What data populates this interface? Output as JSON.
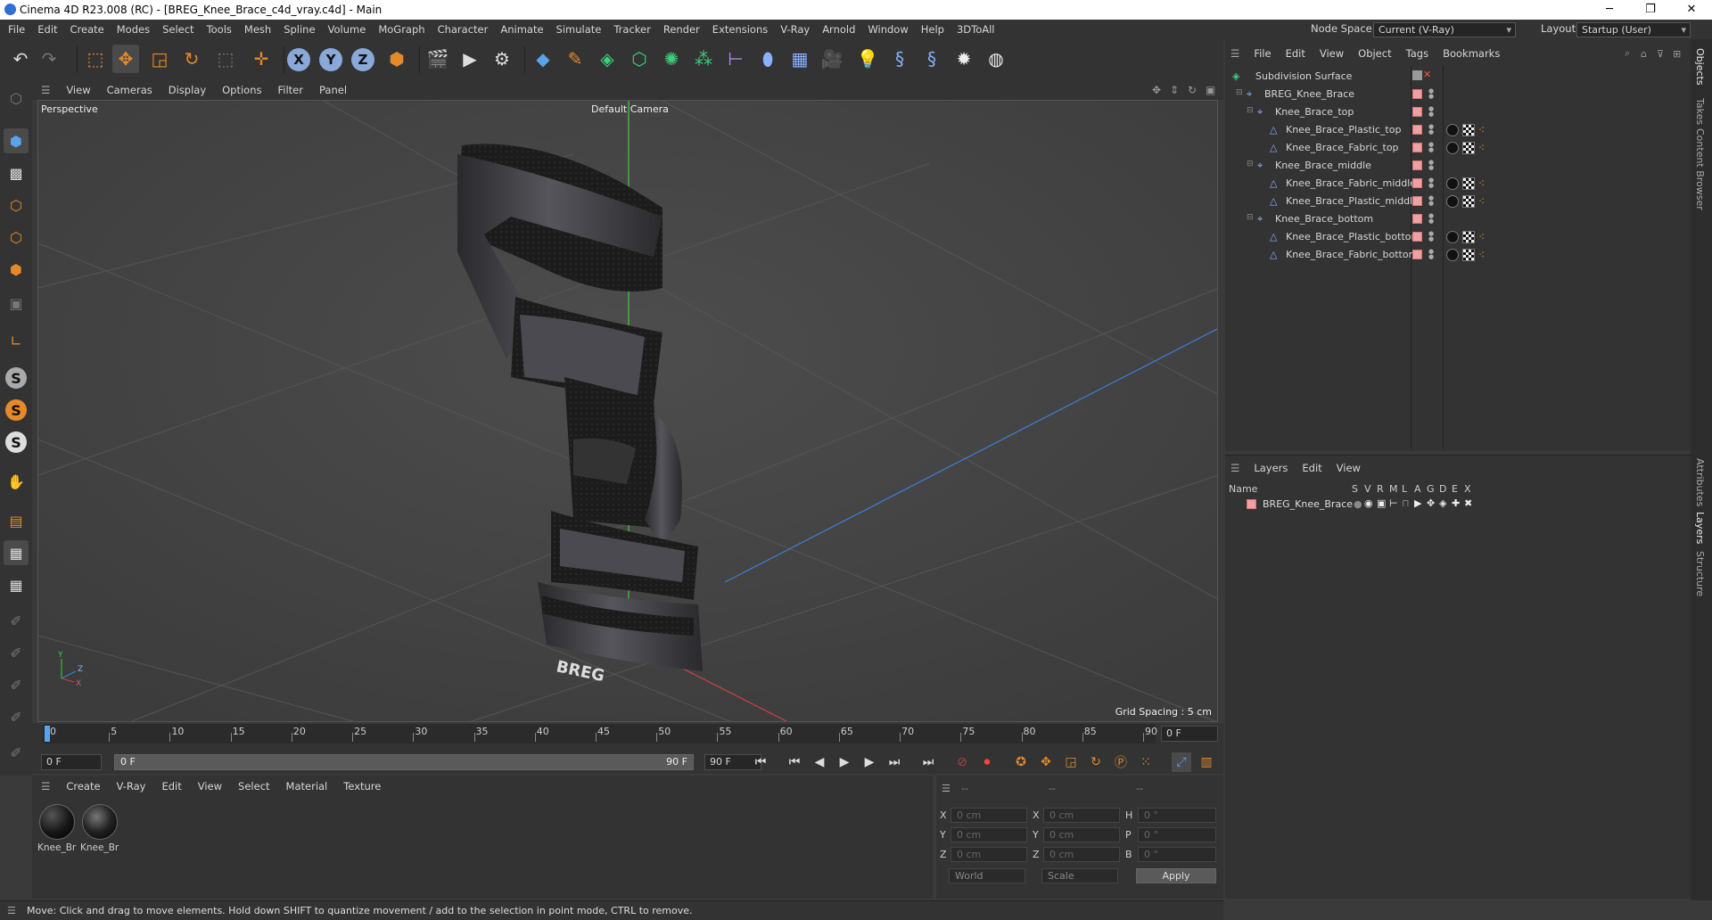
{
  "window": {
    "title": "Cinema 4D R23.008 (RC) - [BREG_Knee_Brace_c4d_vray.c4d] - Main",
    "minimize": "─",
    "maximize": "❐",
    "close": "✕"
  },
  "menubar": {
    "items": [
      "File",
      "Edit",
      "Create",
      "Modes",
      "Select",
      "Tools",
      "Mesh",
      "Spline",
      "Volume",
      "MoGraph",
      "Character",
      "Animate",
      "Simulate",
      "Tracker",
      "Render",
      "Extensions",
      "V-Ray",
      "Arnold",
      "Window",
      "Help",
      "3DToAll"
    ],
    "node_space_label": "Node Space:",
    "node_space_value": "Current (V-Ray)",
    "layout_label": "Layout:",
    "layout_value": "Startup (User)"
  },
  "viewport": {
    "menu": [
      "View",
      "Cameras",
      "Display",
      "Options",
      "Filter",
      "Panel"
    ],
    "view_name": "Perspective",
    "camera_name": "Default Camera",
    "grid_spacing": "Grid Spacing : 5 cm",
    "axis_y": "Y",
    "axis_z": "Z",
    "axis_x": "X",
    "logo_text": "BREG"
  },
  "timeline": {
    "ticks": [
      "0",
      "5",
      "10",
      "15",
      "20",
      "25",
      "30",
      "35",
      "40",
      "45",
      "50",
      "55",
      "60",
      "65",
      "70",
      "75",
      "80",
      "85",
      "90"
    ],
    "current_frame_right": "0 F",
    "start_field": "0 F",
    "range_start": "0 F",
    "range_end": "90 F",
    "end_field": "90 F"
  },
  "material_manager": {
    "menu": [
      "Create",
      "V-Ray",
      "Edit",
      "View",
      "Select",
      "Material",
      "Texture"
    ],
    "materials": [
      {
        "name": "Knee_Bra"
      },
      {
        "name": "Knee_Bra"
      }
    ]
  },
  "coordinates": {
    "header_dashes": [
      "--",
      "--",
      "--"
    ],
    "rows": [
      {
        "a": "X",
        "av": "0 cm",
        "b": "X",
        "bv": "0 cm",
        "c": "H",
        "cv": "0 °"
      },
      {
        "a": "Y",
        "av": "0 cm",
        "b": "Y",
        "bv": "0 cm",
        "c": "P",
        "cv": "0 °"
      },
      {
        "a": "Z",
        "av": "0 cm",
        "b": "Z",
        "bv": "0 cm",
        "c": "B",
        "cv": "0 °"
      }
    ],
    "space": "World",
    "mode": "Scale",
    "apply": "Apply"
  },
  "status": {
    "text": "Move: Click and drag to move elements. Hold down SHIFT to quantize movement / add to the selection in point mode, CTRL to remove."
  },
  "object_manager": {
    "menu": [
      "File",
      "Edit",
      "View",
      "Object",
      "Tags",
      "Bookmarks"
    ],
    "objects": [
      {
        "name": "Subdivision Surface",
        "indent": 0,
        "kind": "subdiv"
      },
      {
        "name": "BREG_Knee_Brace",
        "indent": 1,
        "kind": "null"
      },
      {
        "name": "Knee_Brace_top",
        "indent": 2,
        "kind": "null"
      },
      {
        "name": "Knee_Brace_Plastic_top",
        "indent": 3,
        "kind": "mesh"
      },
      {
        "name": "Knee_Brace_Fabric_top",
        "indent": 3,
        "kind": "mesh"
      },
      {
        "name": "Knee_Brace_middle",
        "indent": 2,
        "kind": "null"
      },
      {
        "name": "Knee_Brace_Fabric_middle",
        "indent": 3,
        "kind": "mesh"
      },
      {
        "name": "Knee_Brace_Plastic_middle",
        "indent": 3,
        "kind": "mesh"
      },
      {
        "name": "Knee_Brace_bottom",
        "indent": 2,
        "kind": "null"
      },
      {
        "name": "Knee_Brace_Plastic_bottom",
        "indent": 3,
        "kind": "mesh"
      },
      {
        "name": "Knee_Brace_Fabric_bottom",
        "indent": 3,
        "kind": "mesh"
      }
    ]
  },
  "layer_manager": {
    "menu": [
      "Layers",
      "Edit",
      "View"
    ],
    "col_name": "Name",
    "col_flags": [
      "S",
      "V",
      "R",
      "M",
      "L",
      "A",
      "G",
      "D",
      "E",
      "X"
    ],
    "layers": [
      {
        "name": "BREG_Knee_Brace",
        "color": "#f08080"
      }
    ]
  },
  "side_tabs": [
    "Objects",
    "Takes",
    "Content Browser",
    "Attributes",
    "Layers",
    "Structure"
  ],
  "colors": {
    "accent_blue": "#3b8ed8",
    "active_orange": "#e58a2a",
    "layer_color": "#f0a0a0"
  }
}
